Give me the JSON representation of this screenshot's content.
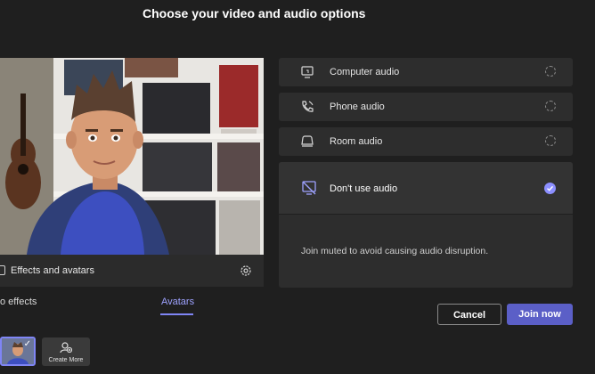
{
  "page": {
    "title": "Choose your video and audio options"
  },
  "preview": {
    "effects_label": "Effects and avatars",
    "tabs": [
      {
        "label": "o effects",
        "active": false
      },
      {
        "label": "Avatars",
        "active": true
      }
    ],
    "create_more_label": "Create More"
  },
  "audio_options": [
    {
      "label": "Computer audio",
      "icon": "computer-icon",
      "selected": false
    },
    {
      "label": "Phone audio",
      "icon": "phone-icon",
      "selected": false
    },
    {
      "label": "Room audio",
      "icon": "room-icon",
      "selected": false
    }
  ],
  "selected_option": {
    "label": "Don't use audio",
    "icon": "no-audio-icon",
    "description": "Join muted to avoid causing audio disruption."
  },
  "buttons": {
    "cancel": "Cancel",
    "join": "Join now"
  },
  "colors": {
    "accent": "#5b5fc7",
    "accent_light": "#8c8fff",
    "background": "#1f1f1f"
  }
}
